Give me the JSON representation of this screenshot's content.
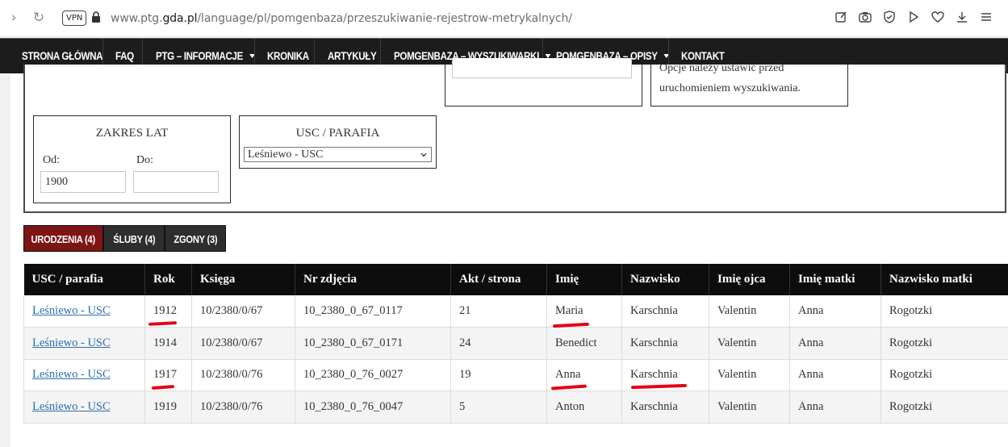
{
  "browser": {
    "vpn_label": "VPN",
    "url_prefix": "www.ptg.",
    "url_domain": "gda.pl",
    "url_path": "/language/pl/pomgenbaza/przeszukiwanie-rejestrow-metrykalnych/"
  },
  "nav": {
    "items": [
      {
        "label": "STRONA GŁÓWNA"
      },
      {
        "label": "FAQ"
      },
      {
        "label": "PTG – INFORMACJE"
      },
      {
        "label": "KRONIKA"
      },
      {
        "label": "ARTYKUŁY"
      },
      {
        "label": "POMGENBAZA – WYSZUKIWARKI"
      },
      {
        "label": "POMGENBAZA – OPISY"
      },
      {
        "label": "KONTAKT"
      }
    ]
  },
  "search": {
    "note_line1": "Opcje należy ustawić przed",
    "note_line2": "uruchomieniem wyszukiwania.",
    "years": {
      "title": "ZAKRES LAT",
      "from_label": "Od:",
      "to_label": "Do:",
      "from_value": "1900",
      "to_value": ""
    },
    "parish": {
      "title": "USC / PARAFIA",
      "selected": "Leśniewo - USC"
    }
  },
  "tabs": [
    {
      "label": "URODZENIA (4)"
    },
    {
      "label": "ŚLUBY (4)"
    },
    {
      "label": "ZGONY (3)"
    }
  ],
  "table": {
    "headers": [
      "USC / parafia",
      "Rok",
      "Księga",
      "Nr zdjęcia",
      "Akt / strona",
      "Imię",
      "Nazwisko",
      "Imię ojca",
      "Imię matki",
      "Nazwisko matki"
    ],
    "rows": [
      [
        "Leśniewo - USC",
        "1912",
        "10/2380/0/67",
        "10_2380_0_67_0117",
        "21",
        "Maria",
        "Karschnia",
        "Valentin",
        "Anna",
        "Rogotzki"
      ],
      [
        "Leśniewo - USC",
        "1914",
        "10/2380/0/67",
        "10_2380_0_67_0171",
        "24",
        "Benedict",
        "Karschnia",
        "Valentin",
        "Anna",
        "Rogotzki"
      ],
      [
        "Leśniewo - USC",
        "1917",
        "10/2380/0/76",
        "10_2380_0_76_0027",
        "19",
        "Anna",
        "Karschnia",
        "Valentin",
        "Anna",
        "Rogotzki"
      ],
      [
        "Leśniewo - USC",
        "1919",
        "10/2380/0/76",
        "10_2380_0_76_0047",
        "5",
        "Anton",
        "Karschnia",
        "Valentin",
        "Anna",
        "Rogotzki"
      ]
    ]
  },
  "colors": {
    "active_tab": "#7d1515",
    "nav_bg": "#1c1c1c",
    "link": "#2e6fb0",
    "annotation": "#e30613"
  }
}
